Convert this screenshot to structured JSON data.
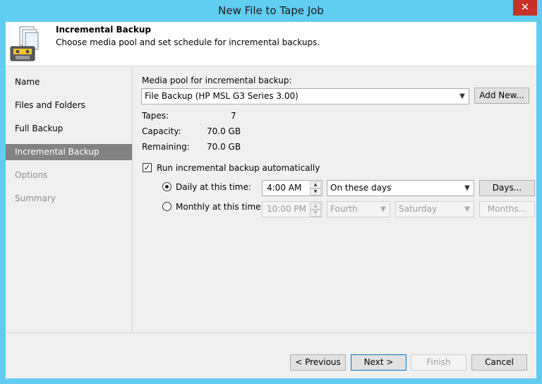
{
  "window": {
    "title": "New File to Tape Job",
    "close_glyph": "✕"
  },
  "header": {
    "title": "Incremental Backup",
    "subtitle": "Choose media pool and set schedule for incremental backups.",
    "icon": "tape-files-icon"
  },
  "nav": {
    "items": [
      {
        "label": "Name",
        "state": "normal"
      },
      {
        "label": "Files and Folders",
        "state": "normal"
      },
      {
        "label": "Full Backup",
        "state": "normal"
      },
      {
        "label": "Incremental Backup",
        "state": "active"
      },
      {
        "label": "Options",
        "state": "disabled"
      },
      {
        "label": "Summary",
        "state": "disabled"
      }
    ]
  },
  "media_pool": {
    "label": "Media pool for incremental backup:",
    "selected": "File Backup (HP MSL G3 Series 3.00)",
    "add_new_label": "Add New..."
  },
  "stats": {
    "tapes_label": "Tapes:",
    "tapes_value": "7",
    "capacity_label": "Capacity:",
    "capacity_value": "70.0 GB",
    "remaining_label": "Remaining:",
    "remaining_value": "70.0 GB"
  },
  "schedule": {
    "run_auto_label": "Run incremental backup automatically",
    "run_auto_checked": true,
    "daily": {
      "label": "Daily at this time:",
      "selected": true,
      "time": "4:00 AM",
      "days_option": "On these days",
      "days_button": "Days..."
    },
    "monthly": {
      "label": "Monthly at this time:",
      "selected": false,
      "time": "10:00 PM",
      "week": "Fourth",
      "weekday": "Saturday",
      "months_button": "Months..."
    }
  },
  "footer": {
    "previous_label": "< Previous",
    "next_label": "Next >",
    "finish_label": "Finish",
    "cancel_label": "Cancel"
  },
  "colors": {
    "title_bar": "#61cdf0",
    "nav_active": "#828282",
    "close_button": "#c7312a"
  }
}
